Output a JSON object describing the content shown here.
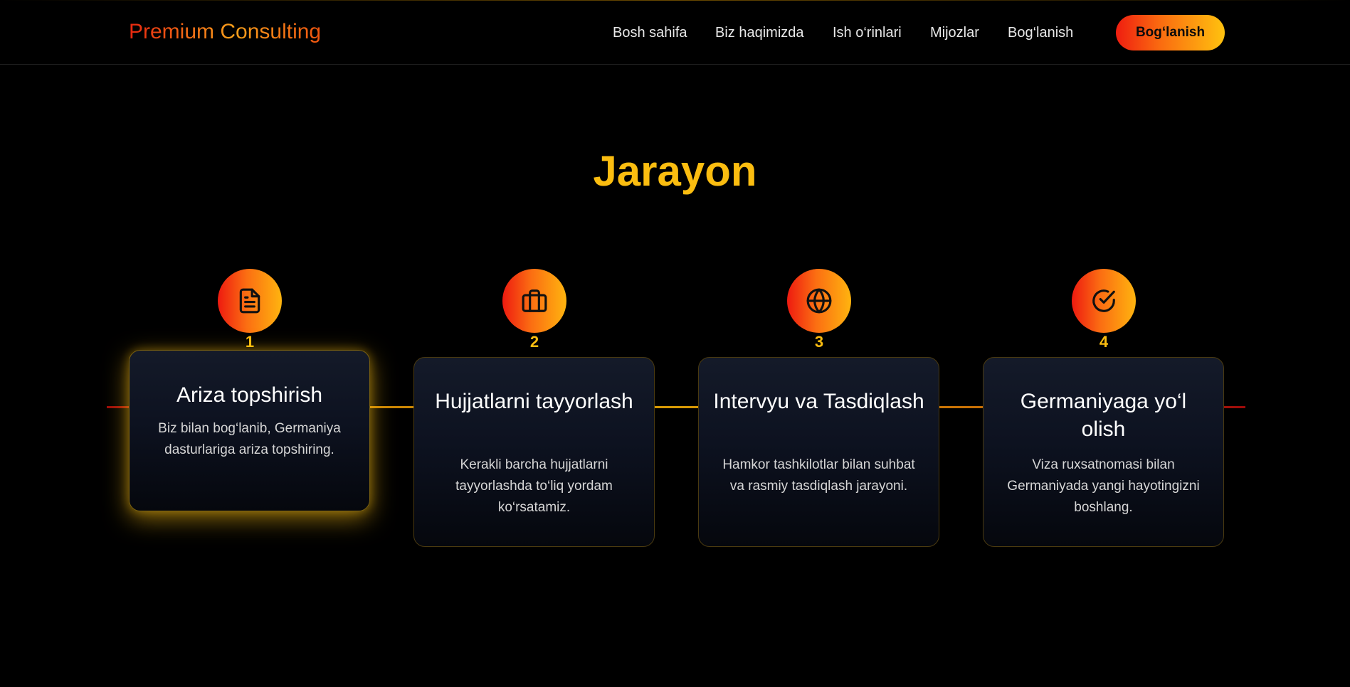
{
  "header": {
    "logo": "Premium Consulting",
    "nav": [
      "Bosh sahifa",
      "Biz haqimizda",
      "Ish o‘rinlari",
      "Mijozlar",
      "Bog‘lanish"
    ],
    "cta_label": "Bog‘lanish"
  },
  "section": {
    "title": "Jarayon"
  },
  "steps": [
    {
      "number": "1",
      "icon": "document-icon",
      "title": "Ariza topshirish",
      "description": "Biz bilan bog‘lanib, Germaniya dasturlariga ariza topshiring.",
      "active": true
    },
    {
      "number": "2",
      "icon": "briefcase-icon",
      "title": "Hujjatlarni tayyorlash",
      "description": "Kerakli barcha hujjatlarni tayyorlashda to‘liq yordam ko‘rsatamiz.",
      "active": false
    },
    {
      "number": "3",
      "icon": "globe-icon",
      "title": "Intervyu va Tasdiqlash",
      "description": "Hamkor tashkilotlar bilan suhbat va rasmiy tasdiqlash jarayoni.",
      "active": false
    },
    {
      "number": "4",
      "icon": "check-circle-icon",
      "title": "Germaniyaga yo‘l olish",
      "description": "Viza ruxsatnomasi bilan Germaniyada yangi hayotingizni boshlang.",
      "active": false
    }
  ],
  "colors": {
    "background": "#000000",
    "accent_gold": "#fbbd10",
    "accent_red": "#ee1a10",
    "accent_orange": "#fb6e12",
    "card_bg": "#0d1220"
  }
}
